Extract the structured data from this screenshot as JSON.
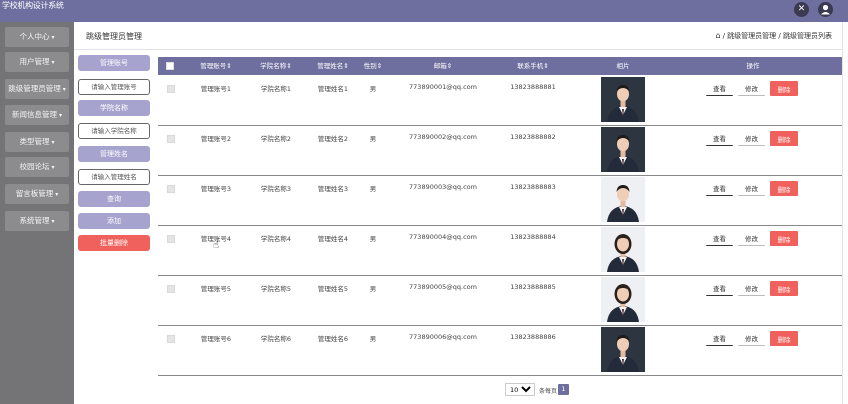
{
  "header": {
    "brand": "学校机构设计系统",
    "icons": [
      "close-circle-icon",
      "user-avatar-icon"
    ]
  },
  "sidebar": {
    "items": [
      {
        "label": "个人中心"
      },
      {
        "label": "用户管理"
      },
      {
        "label": "跳级管理员管理"
      },
      {
        "label": "新闻信息管理"
      },
      {
        "label": "类型管理"
      },
      {
        "label": "校园论坛"
      },
      {
        "label": "留言板管理"
      },
      {
        "label": "系统管理"
      }
    ]
  },
  "breadcrumb": {
    "title": "跳级管理员管理",
    "path": "/ 跳级管理员管理 / 跳级管理员列表"
  },
  "filters": {
    "account_label": "管理账号",
    "account_placeholder": "请输入管理账号",
    "school_label": "学院名称",
    "school_placeholder": "请输入学院名称",
    "name_label": "管理姓名",
    "name_placeholder": "请输入管理姓名",
    "search_label": "查询",
    "add_label": "添加",
    "batch_delete_label": "批量删除"
  },
  "table": {
    "columns": [
      "管理账号⇕",
      "学院名称⇕",
      "管理姓名⇕",
      "性别⇕",
      "邮箱⇕",
      "联系手机⇕",
      "相片",
      "操作"
    ],
    "rows": [
      {
        "account": "管理账号1",
        "school": "学院名称1",
        "name": "管理姓名1",
        "gender": "男",
        "email": "773890001@qq.com",
        "phone": "13823888881",
        "photo": "man-suit"
      },
      {
        "account": "管理账号2",
        "school": "学院名称2",
        "name": "管理姓名2",
        "gender": "男",
        "email": "773890002@qq.com",
        "phone": "13823888882",
        "photo": "man-suit"
      },
      {
        "account": "管理账号3",
        "school": "学院名称3",
        "name": "管理姓名3",
        "gender": "男",
        "email": "773890003@qq.com",
        "phone": "13823888883",
        "photo": "man-suit-light"
      },
      {
        "account": "管理账号4",
        "school": "学院名称4",
        "name": "管理姓名4",
        "gender": "男",
        "email": "773890004@qq.com",
        "phone": "13823888884",
        "photo": "woman-suit"
      },
      {
        "account": "管理账号5",
        "school": "学院名称5",
        "name": "管理姓名5",
        "gender": "男",
        "email": "773890005@qq.com",
        "phone": "13823888885",
        "photo": "woman-suit"
      },
      {
        "account": "管理账号6",
        "school": "学院名称6",
        "name": "管理姓名6",
        "gender": "男",
        "email": "773890006@qq.com",
        "phone": "13823888886",
        "photo": "man-suit"
      }
    ],
    "actions": {
      "view": "查看",
      "edit": "修改",
      "delete": "删除"
    }
  },
  "pagination": {
    "page_size": "10",
    "page_size_options": [
      "10",
      "20",
      "50"
    ],
    "total_label": "条每页",
    "current_page": "1"
  },
  "colors": {
    "accent": "#6e6f9f",
    "filter_label": "#a6a3cf",
    "danger": "#f0605c",
    "sidebar": "#747476"
  }
}
